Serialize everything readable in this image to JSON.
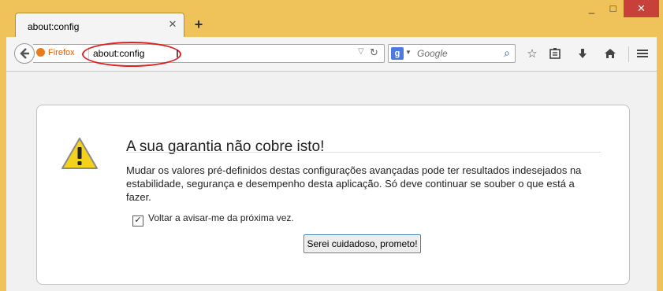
{
  "window": {
    "minimize_glyph": "_",
    "maximize_glyph": "□",
    "close_glyph": "✕"
  },
  "tab": {
    "title": "about:config",
    "close_glyph": "✕",
    "new_tab_glyph": "+"
  },
  "toolbar": {
    "back_icon": "back-arrow-icon",
    "identity_label": "Firefox",
    "url": "about:config",
    "search_engine_glyph": "g",
    "search_placeholder": "Google",
    "icons": [
      "star-icon",
      "reading-list-icon",
      "download-icon",
      "home-icon",
      "menu-icon"
    ]
  },
  "page": {
    "title": "A sua garantia não cobre isto!",
    "body": "Mudar os valores pré-definidos destas configurações avançadas pode ter resultados indesejados na estabilidade, segurança e desempenho desta aplicação. Só deve continuar se souber o que está a fazer.",
    "checkbox_label": "Voltar a avisar-me da próxima vez.",
    "checkbox_checked": true,
    "confirm_button": "Serei cuidadoso, prometo!"
  },
  "colors": {
    "frame": "#f0c35a",
    "annotation_ellipse": "#e02020",
    "warning_icon": "#f2d21b"
  }
}
